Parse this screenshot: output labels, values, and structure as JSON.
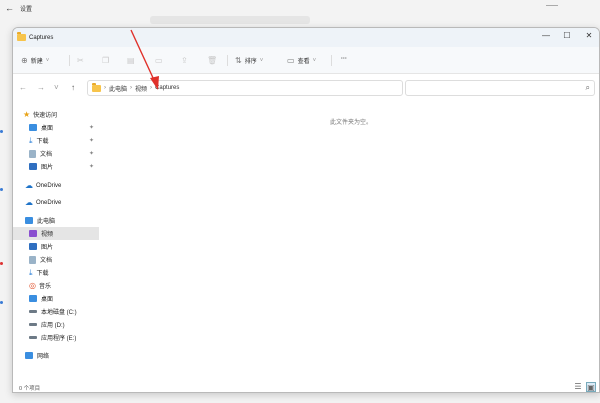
{
  "bg": {
    "back_glyph": "←",
    "title": "设置"
  },
  "window": {
    "tab_title": "Captures",
    "controls": {
      "min": "—",
      "max": "☐",
      "close": "✕"
    }
  },
  "toolbar": {
    "new_label": "新建",
    "sort_label": "排序",
    "view_label": "查看",
    "more_label": "···"
  },
  "address": {
    "segments": [
      "此电脑",
      "视频",
      "Captures"
    ]
  },
  "sidebar": {
    "items": [
      {
        "label": "快速访问",
        "icon": "star-icon"
      },
      {
        "label": "桌面",
        "icon": "desktop-icon",
        "pinned": true
      },
      {
        "label": "下载",
        "icon": "download-icon",
        "pinned": true
      },
      {
        "label": "文档",
        "icon": "document-icon",
        "pinned": true
      },
      {
        "label": "图片",
        "icon": "picture-icon",
        "pinned": true
      },
      {
        "label": "OneDrive",
        "icon": "cloud-icon"
      },
      {
        "label": "OneDrive",
        "icon": "cloud-icon"
      },
      {
        "label": "此电脑",
        "icon": "pc-icon"
      },
      {
        "label": "视频",
        "icon": "video-icon",
        "selected": true
      },
      {
        "label": "图片",
        "icon": "picture-icon"
      },
      {
        "label": "文档",
        "icon": "document-icon"
      },
      {
        "label": "下载",
        "icon": "download-icon"
      },
      {
        "label": "音乐",
        "icon": "music-icon"
      },
      {
        "label": "桌面",
        "icon": "desktop-icon"
      },
      {
        "label": "本地磁盘 (C:)",
        "icon": "drive-icon"
      },
      {
        "label": "应用 (D:)",
        "icon": "drive-icon"
      },
      {
        "label": "应用程序 (E:)",
        "icon": "drive-icon"
      },
      {
        "label": "网络",
        "icon": "network-icon"
      }
    ]
  },
  "content": {
    "empty_text": "此文件夹为空。"
  },
  "status": {
    "count_text": "0 个项目"
  },
  "colors": {
    "accent": "#1e73c8",
    "annotation": "#e0302a",
    "folder": "#f7c44b"
  }
}
